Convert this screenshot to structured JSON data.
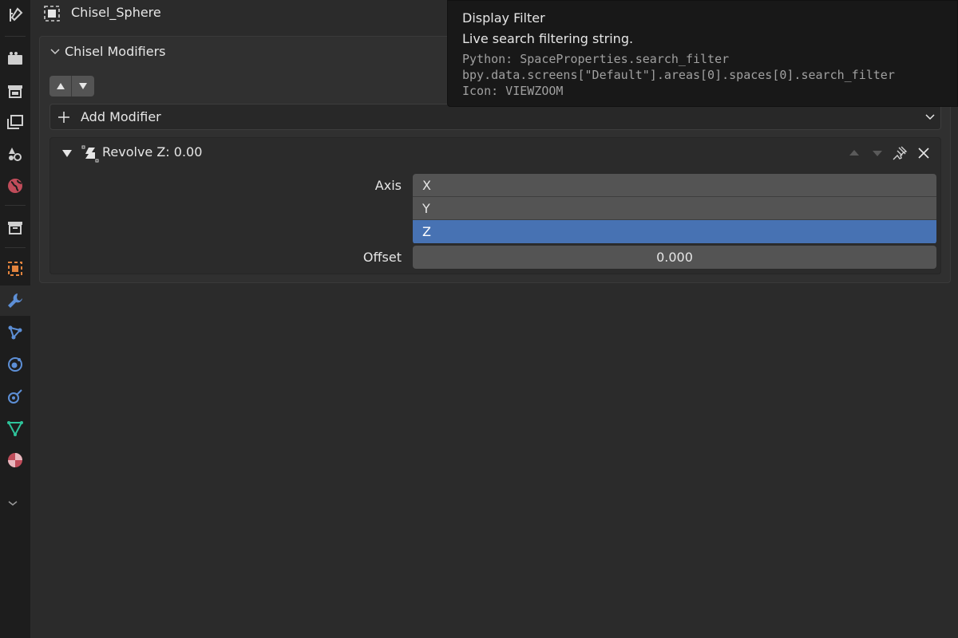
{
  "header": {
    "object_name": "Chisel_Sphere"
  },
  "panel": {
    "title": "Chisel Modifiers",
    "add_modifier_label": "Add Modifier"
  },
  "modifier": {
    "title": "Revolve Z: 0.00",
    "axis_label": "Axis",
    "axis_options": [
      "X",
      "Y",
      "Z"
    ],
    "axis_selected": "Z",
    "offset_label": "Offset",
    "offset_value": "0.000"
  },
  "tooltip": {
    "title": "Display Filter",
    "description": "Live search filtering string.",
    "python": "Python: SpaceProperties.search_filter",
    "path": "bpy.data.screens[\"Default\"].areas[0].spaces[0].search_filter",
    "icon": "Icon: VIEWZOOM"
  },
  "tabs": [
    "tool-icon",
    "render-icon",
    "output-icon",
    "view-layer-icon",
    "scene-icon",
    "world-icon",
    "collection-icon",
    "object-icon",
    "modifier-icon",
    "particles-icon",
    "physics-icon",
    "constraints-icon",
    "data-icon",
    "material-icon",
    "more-icon"
  ],
  "colors": {
    "selected": "#4772b3",
    "modifier_tab": "#5d8fd6",
    "object_tab": "#e2843e"
  }
}
